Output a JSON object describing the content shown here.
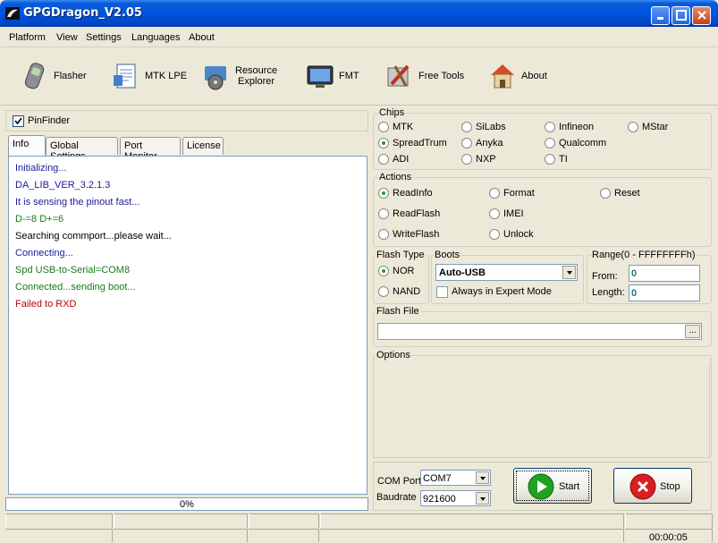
{
  "window": {
    "title": "GPGDragon_V2.05"
  },
  "menu": [
    "Platform",
    "View",
    "Settings",
    "Languages",
    "About"
  ],
  "toolbar": {
    "flasher": "Flasher",
    "mtk_lpe": "MTK LPE",
    "resource_explorer_1": "Resource",
    "resource_explorer_2": "Explorer",
    "fmt": "FMT",
    "free_tools": "Free Tools",
    "about": "About"
  },
  "left": {
    "pinfinder": "PinFinder",
    "tabs": [
      "Info",
      "Global Settings",
      "Port Monitor",
      "License"
    ],
    "log": [
      {
        "text": "Initializing...",
        "color": "#1a1a9a"
      },
      {
        "text": "DA_LIB_VER_3.2.1.3",
        "color": "#1a1a9a"
      },
      {
        "text": "It is sensing the pinout fast...",
        "color": "#1a1a9a"
      },
      {
        "text": "D-=8  D+=6",
        "color": "#1a7a1a"
      },
      {
        "text": "Searching commport...please wait...",
        "color": "#000000"
      },
      {
        "text": "Connecting...",
        "color": "#1a1a9a"
      },
      {
        "text": "Spd USB-to-Serial=COM8",
        "color": "#1a7a1a"
      },
      {
        "text": "Connected...sending boot...",
        "color": "#1a7a1a"
      },
      {
        "text": "Failed to RXD",
        "color": "#c00000"
      }
    ],
    "progress_label": "0%",
    "progress_value": 0
  },
  "chips": {
    "legend": "Chips",
    "items": [
      "MTK",
      "SiLabs",
      "Infineon",
      "MStar",
      "SpreadTrum",
      "Anyka",
      "Qualcomm",
      "ADI",
      "NXP",
      "TI"
    ],
    "selected": "SpreadTrum"
  },
  "actions": {
    "legend": "Actions",
    "items": [
      "ReadInfo",
      "Format",
      "Reset",
      "ReadFlash",
      "IMEI",
      "WriteFlash",
      "Unlock"
    ],
    "selected": "ReadInfo"
  },
  "flash_type": {
    "legend": "Flash Type",
    "nor": "NOR",
    "nand": "NAND",
    "selected": "NOR"
  },
  "boots": {
    "legend": "Boots",
    "value": "Auto-USB",
    "expert": "Always in Expert Mode"
  },
  "range": {
    "legend": "Range(0 - FFFFFFFFh)",
    "from_label": "From:",
    "from_value": "0",
    "length_label": "Length:",
    "length_value": "0"
  },
  "flash_file": {
    "legend": "Flash File",
    "browse": "..."
  },
  "options": {
    "legend": "Options"
  },
  "com": {
    "port_label": "COM Port",
    "port_value": "COM7",
    "baud_label": "Baudrate",
    "baud_value": "921600"
  },
  "buttons": {
    "start": "Start",
    "stop": "Stop"
  },
  "status": {
    "timer": "00:00:05"
  },
  "colors": {
    "title_blue": "#0053e0",
    "accent_green": "#21a121",
    "stop_red": "#d81e1e"
  }
}
